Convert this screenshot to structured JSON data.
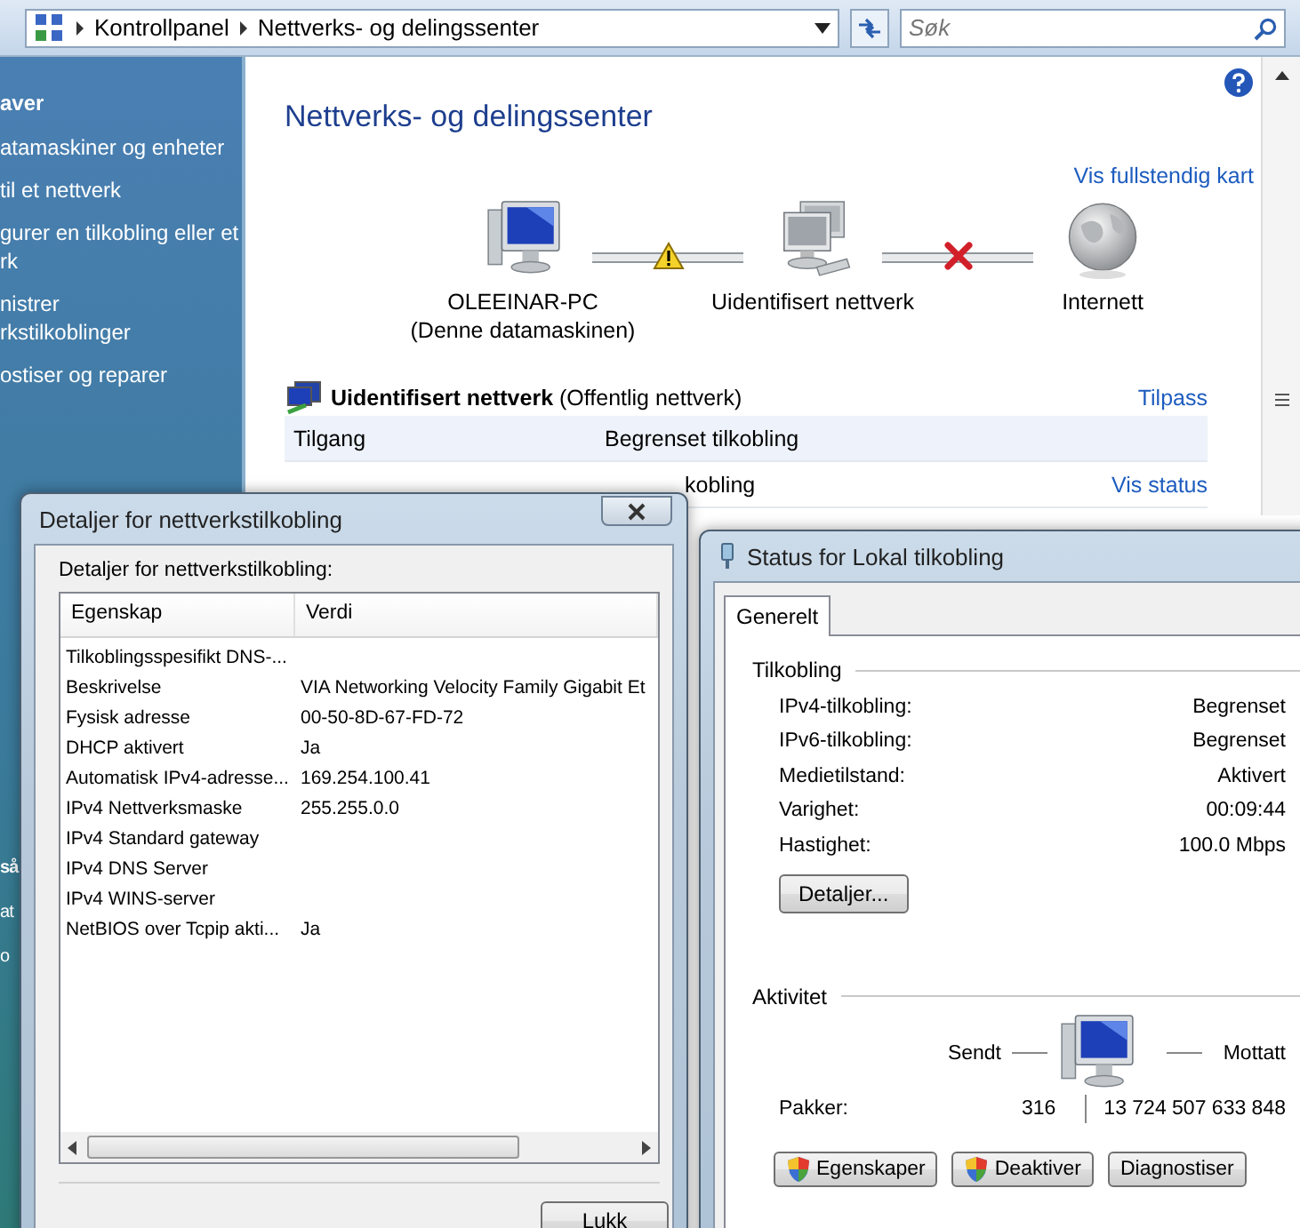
{
  "address_bar": {
    "breadcrumbs": [
      "Kontrollpanel",
      "Nettverks- og delingssenter"
    ],
    "search": {
      "placeholder": "Søk"
    }
  },
  "sidebar": {
    "items": [
      {
        "kind": "heading",
        "lines": [
          "aver"
        ]
      },
      {
        "kind": "link",
        "lines": [
          "atamaskiner og enheter"
        ]
      },
      {
        "kind": "link",
        "lines": [
          "til et nettverk"
        ]
      },
      {
        "kind": "link",
        "lines": [
          "gurer en tilkobling eller et",
          "rk"
        ]
      },
      {
        "kind": "link",
        "lines": [
          "nistrer",
          "rkstilkoblinger"
        ]
      },
      {
        "kind": "link",
        "lines": [
          "ostiser og reparer"
        ]
      }
    ],
    "bottom_items": [
      {
        "kind": "heading",
        "lines": [
          "så"
        ]
      },
      {
        "kind": "link",
        "lines": [
          "at"
        ]
      },
      {
        "kind": "link",
        "lines": [
          "o"
        ]
      }
    ]
  },
  "main": {
    "title": "Nettverks- og delingssenter",
    "map_link": "Vis fullstendig kart",
    "map": {
      "nodes": [
        {
          "kind": "computer",
          "name": "OLEEINAR-PC",
          "subtitle": "(Denne datamaskinen)"
        },
        {
          "kind": "network",
          "name": "Uidentifisert nettverk"
        },
        {
          "kind": "globe",
          "name": "Internett"
        }
      ],
      "links": [
        {
          "kind": "warning"
        },
        {
          "kind": "broken"
        }
      ]
    },
    "network": {
      "name": "Uidentifisert nettverk",
      "type": "(Offentlig nettverk)",
      "action": "Tilpass",
      "rows": [
        {
          "label": "Tilgang",
          "value": "Begrenset tilkobling"
        },
        {
          "value": "kobling",
          "action": "Vis status"
        }
      ]
    }
  },
  "details_dialog": {
    "title": "Detaljer for nettverkstilkobling",
    "label": "Detaljer for nettverkstilkobling:",
    "columns": [
      "Egenskap",
      "Verdi"
    ],
    "rows": [
      [
        "Tilkoblingsspesifikt DNS-...",
        ""
      ],
      [
        "Beskrivelse",
        "VIA Networking Velocity Family Gigabit Et"
      ],
      [
        "Fysisk adresse",
        "00-50-8D-67-FD-72"
      ],
      [
        "DHCP aktivert",
        "Ja"
      ],
      [
        "Automatisk IPv4-adresse...",
        "169.254.100.41"
      ],
      [
        "IPv4 Nettverksmaske",
        "255.255.0.0"
      ],
      [
        "IPv4 Standard gateway",
        ""
      ],
      [
        "IPv4 DNS Server",
        ""
      ],
      [
        "IPv4 WINS-server",
        ""
      ],
      [
        "NetBIOS over Tcpip akti...",
        "Ja"
      ]
    ],
    "close_button": "Lukk"
  },
  "status_dialog": {
    "title": "Status for Lokal tilkobling",
    "tabs": [
      {
        "label": "Generelt",
        "selected": true
      }
    ],
    "connection": {
      "title": "Tilkobling",
      "rows": [
        {
          "label": "IPv4-tilkobling:",
          "value": "Begrenset"
        },
        {
          "label": "IPv6-tilkobling:",
          "value": "Begrenset"
        },
        {
          "label": "Medietilstand:",
          "value": "Aktivert"
        },
        {
          "label": "Varighet:",
          "value": "00:09:44"
        },
        {
          "label": "Hastighet:",
          "value": "100.0 Mbps"
        }
      ],
      "details_button": "Detaljer..."
    },
    "activity": {
      "title": "Aktivitet",
      "sent_label": "Sendt",
      "received_label": "Mottatt",
      "packets_label": "Pakker:",
      "packets_sent": "316",
      "packets_received": "13 724 507 633 848"
    },
    "buttons": [
      {
        "label": "Egenskaper",
        "shield": true
      },
      {
        "label": "Deaktiver",
        "shield": true
      },
      {
        "label": "Diagnostiser",
        "shield": false
      }
    ]
  }
}
